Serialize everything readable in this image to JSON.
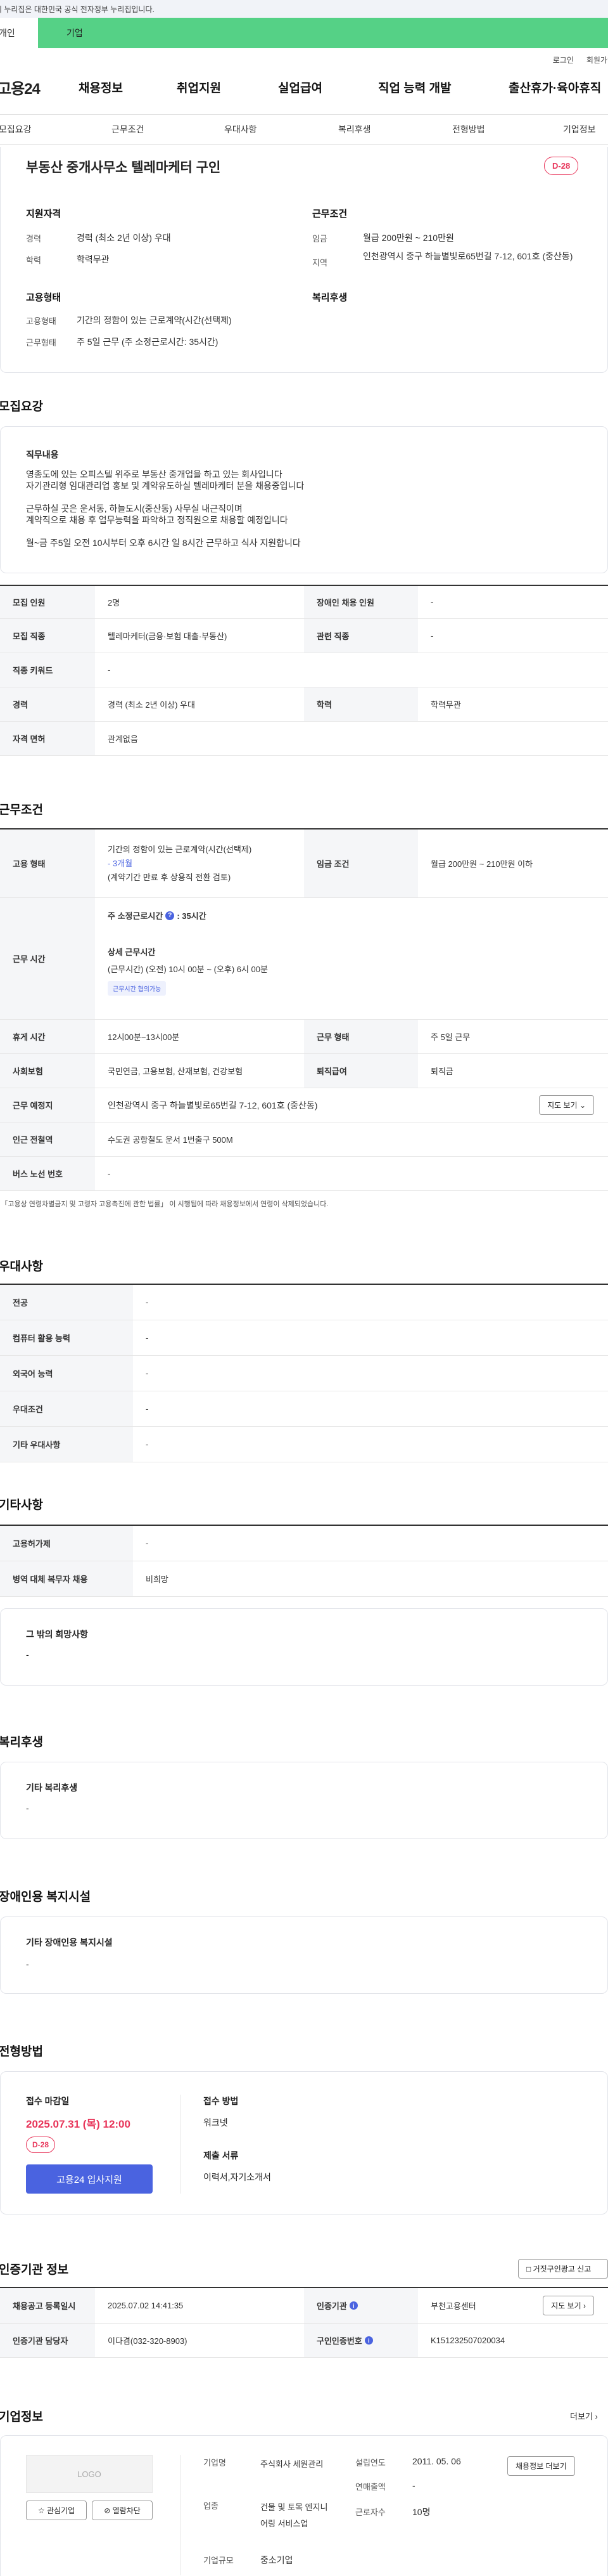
{
  "gov_banner": "이 누리집은 대한민국 공식 전자정부 누리집입니다.",
  "top_tabs": [
    "개인",
    "기업"
  ],
  "util": [
    "로그인",
    "회원가입"
  ],
  "logo": "고용24",
  "gnb": [
    "채용정보",
    "취업지원",
    "실업급여",
    "직업 능력 개발",
    "출산휴가·육아휴직"
  ],
  "sub_nav": [
    "모집요강",
    "근무조건",
    "우대사항",
    "복리후생",
    "전형방법",
    "기업정보"
  ],
  "job": {
    "title": "부동산 중개사무소 텔레마케터 구인",
    "dday": "D-28"
  },
  "summary": {
    "qual_title": "지원자격",
    "cond_title": "근무조건",
    "emp_title": "고용형태",
    "welfare_title": "복리후생",
    "qual": [
      {
        "k": "경력",
        "v": "경력 (최소 2년 이상) 우대"
      },
      {
        "k": "학력",
        "v": "학력무관"
      }
    ],
    "cond": [
      {
        "k": "임금",
        "v": "월급 200만원 ~ 210만원"
      },
      {
        "k": "지역",
        "v": "인천광역시 중구 하늘별빛로65번길 7-12, 601호 (중산동)"
      }
    ],
    "emp": [
      {
        "k": "고용형태",
        "v": "기간의 정함이 있는 근로계약(시간(선택제)"
      },
      {
        "k": "근무형태",
        "v": "주 5일 근무 (주 소정근로시간: 35시간)"
      }
    ]
  },
  "recruit": {
    "title": "모집요강",
    "duty_title": "직무내용",
    "duty_lines": [
      "영종도에 있는 오피스텔 위주로 부동산 중개업을 하고 있는 회사입니다",
      "자기관리형 임대관리업 홍보 및 계약유도하실 텔레마케터 분을 채용중입니다",
      "",
      "근무하실 곳은 운서동, 하늘도시(중산동) 사무실 내근직이며",
      "계약직으로 채용 후 업무능력을 파악하고 정직원으로 채용할 예정입니다",
      "",
      "월~금 주5일 오전 10시부터 오후 6시간 일 8시간 근무하고 식사 지원합니다"
    ],
    "rows": [
      [
        {
          "k": "모집 인원",
          "v": "2명"
        },
        {
          "k": "장애인 채용 인원",
          "v": "-"
        }
      ],
      [
        {
          "k": "모집 직종",
          "v": "텔레마케터(금융·보험 대출·부동산)"
        },
        {
          "k": "관련 직종",
          "v": "-"
        }
      ],
      [
        {
          "k": "직종 키워드",
          "v": "-"
        }
      ],
      [
        {
          "k": "경력",
          "v": "경력 (최소 2년 이상) 우대"
        },
        {
          "k": "학력",
          "v": "학력무관"
        }
      ],
      [
        {
          "k": "자격 면허",
          "v": "관계없음"
        }
      ]
    ]
  },
  "condition": {
    "title": "근무조건",
    "emp_k": "고용 형태",
    "emp_v1": "기간의 정함이 있는 근로계약(시간(선택제)",
    "emp_v2": "- 3개월",
    "emp_v3": "(계약기간 만료 후 상용직 전환 검토)",
    "wage_k": "임금 조건",
    "wage_v": "월급 200만원 ~ 210만원 이하",
    "time_k": "근무 시간",
    "time_h1": "주 소정근로시간",
    "time_h1v": ": 35시간",
    "time_h2": "상세 근무시간",
    "time_v": "(근무시간) (오전) 10시 00분 ~ (오후) 6시 00분",
    "time_badge": "근무시간 협의가능",
    "rest_k": "휴게 시간",
    "rest_v": "12시00분~13시00분",
    "shape_k": "근무 형태",
    "shape_v": "주 5일 근무",
    "ins_k": "사회보험",
    "ins_v": "국민연금, 고용보험, 산재보험, 건강보험",
    "ret_k": "퇴직급여",
    "ret_v": "퇴직금",
    "loc_k": "근무 예정지",
    "loc_v": "인천광역시 중구 하늘별빛로65번길 7-12, 601호 (중산동)",
    "map_btn": "지도 보기",
    "sub_k": "인근 전철역",
    "sub_v": "수도권 공항철도 운서 1번출구 500M",
    "bus_k": "버스 노선 번호",
    "bus_v": "-",
    "note": "* 「고용상 연령차별금지 및 고령자 고용촉진에 관한 법률」 이 시행됨에 따라 채용정보에서 연령이 삭제되었습니다."
  },
  "preference": {
    "title": "우대사항",
    "rows": [
      {
        "k": "전공",
        "v": "-"
      },
      {
        "k": "컴퓨터 활용 능력",
        "v": "-"
      },
      {
        "k": "외국어 능력",
        "v": "-"
      },
      {
        "k": "우대조건",
        "v": "-"
      },
      {
        "k": "기타 우대사항",
        "v": "-"
      }
    ]
  },
  "other": {
    "title": "기타사항",
    "rows": [
      {
        "k": "고용허가제",
        "v": "-"
      },
      {
        "k": "병역 대체 복무자 채용",
        "v": "비희망"
      }
    ],
    "hope_title": "그 밖의 희망사항",
    "hope_v": "-"
  },
  "benefit": {
    "title": "복리후생",
    "box_title": "기타 복리후생",
    "box_v": "-"
  },
  "disabled": {
    "title": "장애인용 복지시설",
    "box_title": "기타 장애인용 복지시설",
    "box_v": "-"
  },
  "process": {
    "title": "전형방법",
    "deadline_k": "접수 마감일",
    "deadline_v": "2025.07.31 (목) 12:00",
    "dday": "D-28",
    "apply_btn": "고용24 입사지원",
    "method_k": "접수 방법",
    "method_v": "워크넷",
    "docs_k": "제출 서류",
    "docs_v": "이력서,자기소개서"
  },
  "cert": {
    "title": "인증기관 정보",
    "report_btn": "거짓구인광고 신고",
    "rows": [
      [
        {
          "k": "채용공고 등록일시",
          "v": "2025.07.02 14:41:35"
        },
        {
          "k": "인증기관",
          "v": "부천고용센터"
        }
      ],
      [
        {
          "k": "인증기관 담당자",
          "v": "이다겸(032-320-8903)"
        },
        {
          "k": "구인인증번호",
          "v": "K151232507020034"
        }
      ]
    ],
    "map_btn": "지도 보기"
  },
  "company": {
    "title": "기업정보",
    "more": "더보기",
    "logo": "LOGO",
    "fav_btn": "관심기업",
    "block_btn": "열람차단",
    "name_k": "기업명",
    "name_v": "주식회사 세원관리",
    "found_k": "설립연도",
    "found_v": "2011. 05. 06",
    "sales_k": "연매출액",
    "sales_v": "-",
    "ind_k": "업종",
    "ind_v": "건물 및 토목 엔지니어링 서비스업",
    "emp_k": "근로자수",
    "emp_v": "10명",
    "size_k": "기업규모",
    "size_v": "중소기업",
    "recruit_btn": "채용정보 더보기"
  },
  "colors": {
    "accent": "#e8355a",
    "primary": "#4a63e0",
    "green": "#55d186"
  }
}
